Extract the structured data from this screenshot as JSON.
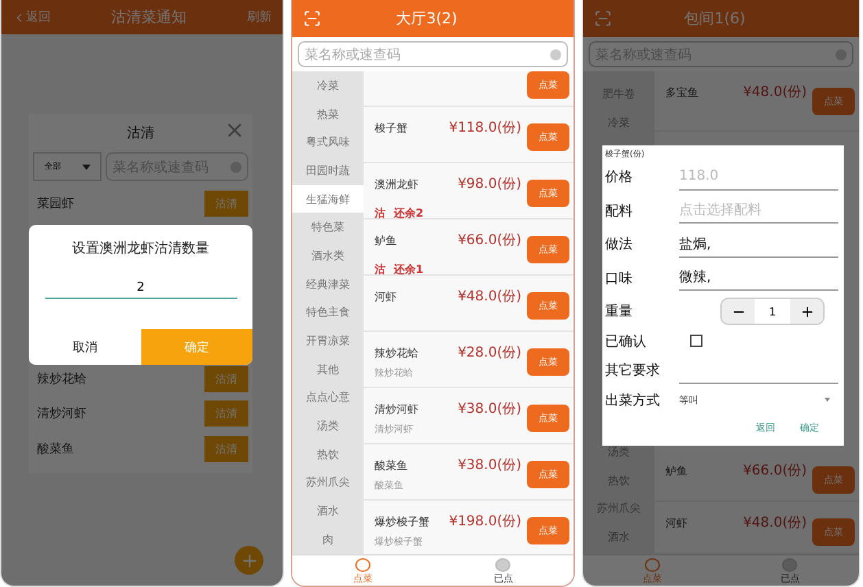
{
  "sold_out_screen": {
    "back": "返回",
    "title": "沽清菜通知",
    "refresh": "刷新",
    "panel": {
      "title": "沽清",
      "filter": "全部",
      "search_placeholder": "菜名称或速查码",
      "items": [
        {
          "name": "菜园虾",
          "action": "沽清"
        },
        {
          "name": "辣炒花蛤",
          "action": "沽清"
        },
        {
          "name": "清炒河虾",
          "action": "沽清"
        },
        {
          "name": "酸菜鱼",
          "action": "沽清"
        }
      ]
    },
    "quantity_dialog": {
      "title": "设置澳洲龙虾沽清数量",
      "value": "2",
      "cancel": "取消",
      "confirm": "确定"
    }
  },
  "order_screen": {
    "title": "大厅3(2)",
    "search_placeholder": "菜名称或速查码",
    "categories": [
      {
        "label": "冷菜",
        "selected": false
      },
      {
        "label": "热菜",
        "selected": false
      },
      {
        "label": "粤式风味",
        "selected": false
      },
      {
        "label": "田园时蔬",
        "selected": false
      },
      {
        "label": "生猛海鲜",
        "selected": true
      },
      {
        "label": "特色菜",
        "selected": false
      },
      {
        "label": "酒水类",
        "selected": false
      },
      {
        "label": "经典津菜",
        "selected": false
      },
      {
        "label": "特色主食",
        "selected": false
      },
      {
        "label": "开胃凉菜",
        "selected": false
      },
      {
        "label": "其他",
        "selected": false
      },
      {
        "label": "点点心意",
        "selected": false
      },
      {
        "label": "汤类",
        "selected": false
      },
      {
        "label": "热饮",
        "selected": false
      },
      {
        "label": "苏州爪尖",
        "selected": false
      },
      {
        "label": "酒水",
        "selected": false
      },
      {
        "label": "肉",
        "selected": false
      }
    ],
    "dishes": [
      {
        "button": "点菜"
      },
      {
        "name": "梭子蟹",
        "price": "¥118.0(份)",
        "button": "点菜"
      },
      {
        "name": "澳洲龙虾",
        "price": "¥98.0(份)",
        "sold_out": "沽",
        "remaining": "还余2",
        "button": "点菜"
      },
      {
        "name": "鲈鱼",
        "price": "¥66.0(份)",
        "sold_out": "沽",
        "remaining": "还余1",
        "button": "点菜"
      },
      {
        "name": "河虾",
        "price": "¥48.0(份)",
        "button": "点菜"
      },
      {
        "name": "辣炒花蛤",
        "subtitle": "辣炒花蛤",
        "price": "¥28.0(份)",
        "button": "点菜"
      },
      {
        "name": "清炒河虾",
        "subtitle": "清炒河虾",
        "price": "¥38.0(份)",
        "button": "点菜"
      },
      {
        "name": "酸菜鱼",
        "subtitle": "酸菜鱼",
        "price": "¥38.0(份)",
        "button": "点菜"
      },
      {
        "name": "爆炒梭子蟹",
        "subtitle": "爆炒梭子蟹",
        "price": "¥198.0(份)",
        "button": "点菜"
      }
    ],
    "tabs": [
      {
        "label": "点菜",
        "selected": true
      },
      {
        "label": "已点",
        "selected": false
      }
    ]
  },
  "dish_screen": {
    "title": "包间1(6)",
    "search_placeholder": "菜名称或速查码",
    "categories_top": [
      "肥牛卷",
      "冷菜"
    ],
    "categories_bottom": [
      "汤类",
      "热饮",
      "苏州爪尖",
      "酒水"
    ],
    "dishes_top": [
      {
        "name": "多宝鱼",
        "price": "¥48.0(份)",
        "button": "点菜"
      }
    ],
    "dishes_bottom": [
      {
        "name": "鲈鱼",
        "price": "¥66.0(份)",
        "button": "点菜"
      },
      {
        "name": "河虾",
        "price": "¥48.0(份)",
        "button": "点菜"
      }
    ],
    "tabs": [
      {
        "label": "点菜",
        "selected": true
      },
      {
        "label": "已点",
        "selected": false
      }
    ],
    "dish_dialog": {
      "title": "梭子蟹(份)",
      "fields": [
        {
          "kind": "text",
          "label": "价格",
          "placeholder": "118.0"
        },
        {
          "kind": "text",
          "label": "配料",
          "placeholder": "点击选择配料"
        },
        {
          "kind": "text",
          "label": "做法",
          "value": "盐焗,"
        },
        {
          "kind": "text",
          "label": "口味",
          "value": "微辣,"
        },
        {
          "kind": "stepper",
          "label": "重量",
          "value": "1"
        },
        {
          "kind": "checkbox",
          "label": "已确认",
          "checked": false
        },
        {
          "kind": "text",
          "label": "其它要求"
        },
        {
          "kind": "select",
          "label": "出菜方式",
          "value": "等叫"
        }
      ],
      "back": "返回",
      "confirm": "确定"
    }
  }
}
